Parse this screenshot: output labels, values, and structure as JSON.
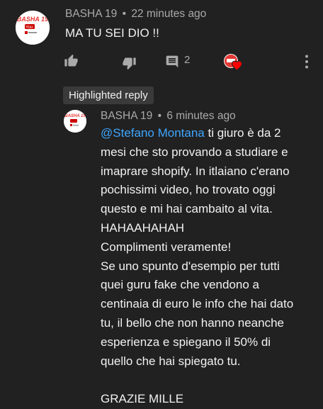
{
  "comment": {
    "avatar_text": "BASHA 19",
    "author": "BASHA 19",
    "separator": "•",
    "time": "22 minutes ago",
    "text": "MA TU SEI DIO !!",
    "reply_count": "2",
    "icons": {
      "like": "thumbs-up-icon",
      "dislike": "thumbs-down-icon",
      "reply": "comment-icon",
      "creator_heart": "creator-heart-icon",
      "menu": "more-vert-icon"
    }
  },
  "highlighted_label": "Highlighted reply",
  "reply": {
    "avatar_text": "BASHA 19",
    "author": "BASHA 19",
    "separator": "•",
    "time": "6 minutes ago",
    "mention": "@Stefano Montana",
    "first_line_rest": " ti giuro è da 2",
    "lines": [
      "mesi che sto provando a studiare e",
      "imaprare shopify. In itlaiano c'erano",
      "pochissimi video, ho trovato oggi",
      "questo e mi hai cambaito al vita.",
      "HAHAAHAHAH",
      "Complimenti veramente!",
      "Se uno spunto d'esempio per tutti",
      "quei guru fake che vendono a",
      "centinaia di euro le info che hai dato",
      "tu, il bello che non hanno neanche",
      "esperienza e spiegano il 50% di",
      "quello che hai spiegato tu.",
      "",
      "GRAZIE MILLE"
    ]
  },
  "colors": {
    "background": "#212121",
    "text": "#f1f1f1",
    "secondary_text": "#aaaaaa",
    "mention": "#3ea6ff",
    "chip": "#3a3a3a",
    "heart": "#ff0000"
  }
}
